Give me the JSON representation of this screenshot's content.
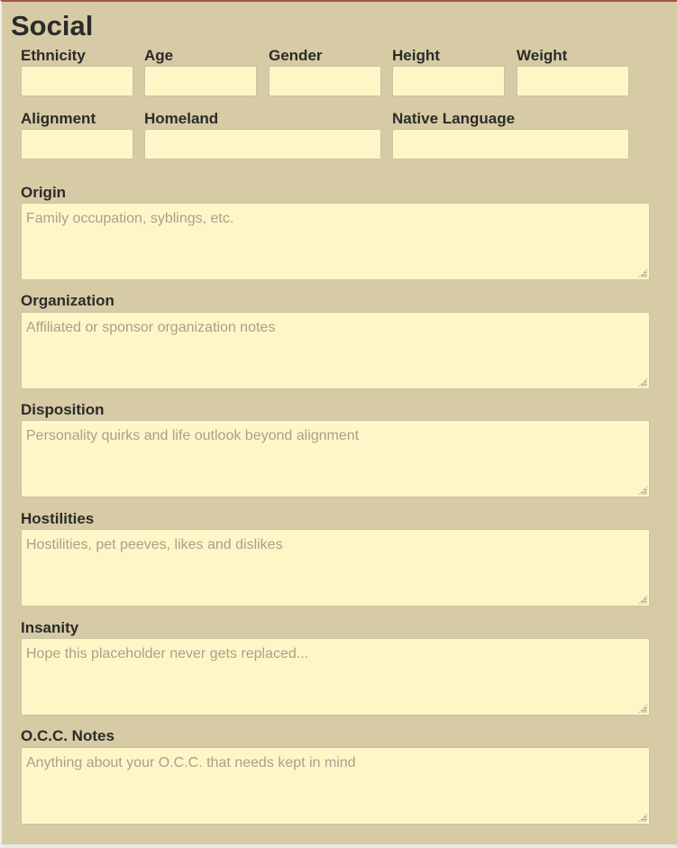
{
  "section": {
    "title": "Social"
  },
  "fields": {
    "ethnicity": {
      "label": "Ethnicity",
      "value": ""
    },
    "age": {
      "label": "Age",
      "value": ""
    },
    "gender": {
      "label": "Gender",
      "value": ""
    },
    "height": {
      "label": "Height",
      "value": ""
    },
    "weight": {
      "label": "Weight",
      "value": ""
    },
    "alignment": {
      "label": "Alignment",
      "value": ""
    },
    "homeland": {
      "label": "Homeland",
      "value": ""
    },
    "native_language": {
      "label": "Native Language",
      "value": ""
    }
  },
  "notes": {
    "origin": {
      "label": "Origin",
      "placeholder": "Family occupation, syblings, etc.",
      "value": ""
    },
    "organization": {
      "label": "Organization",
      "placeholder": "Affiliated or sponsor organization notes",
      "value": ""
    },
    "disposition": {
      "label": "Disposition",
      "placeholder": "Personality quirks and life outlook beyond alignment",
      "value": ""
    },
    "hostilities": {
      "label": "Hostilities",
      "placeholder": "Hostilities, pet peeves, likes and dislikes",
      "value": ""
    },
    "insanity": {
      "label": "Insanity",
      "placeholder": "Hope this placeholder never gets replaced...",
      "value": ""
    },
    "occ_notes": {
      "label": "O.C.C. Notes",
      "placeholder": "Anything about your O.C.C. that needs kept in mind",
      "value": ""
    }
  },
  "colors": {
    "panel_background": "#d6cba4",
    "field_background": "#fff6c8",
    "label_text": "#2b2b2b",
    "placeholder_text": "#a9a189",
    "top_border": "#a0544a"
  },
  "icons": {
    "textarea_resize": "resize-grip-icon"
  }
}
